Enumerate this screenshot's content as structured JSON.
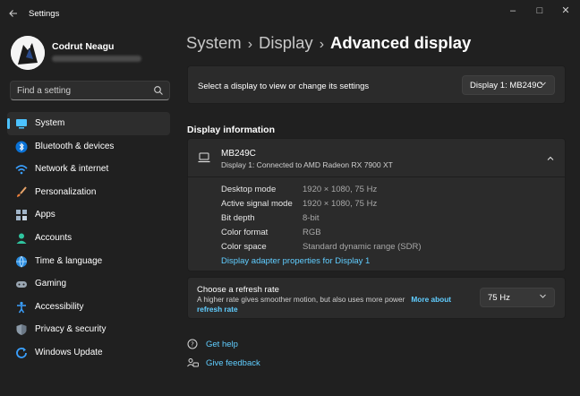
{
  "window": {
    "title": "Settings",
    "back_icon": "back-arrow-icon",
    "minimize_glyph": "–",
    "maximize_glyph": "□",
    "close_glyph": "✕"
  },
  "user": {
    "name": "Codrut Neagu",
    "email_redacted": true
  },
  "search": {
    "placeholder": "Find a setting",
    "icon": "search-icon"
  },
  "sidebar": {
    "accent_color": "#4cc2ff",
    "items": [
      {
        "label": "System",
        "icon": "system-icon",
        "active": true
      },
      {
        "label": "Bluetooth & devices",
        "icon": "bluetooth-icon",
        "active": false
      },
      {
        "label": "Network & internet",
        "icon": "wifi-icon",
        "active": false
      },
      {
        "label": "Personalization",
        "icon": "brush-icon",
        "active": false
      },
      {
        "label": "Apps",
        "icon": "apps-icon",
        "active": false
      },
      {
        "label": "Accounts",
        "icon": "accounts-icon",
        "active": false
      },
      {
        "label": "Time & language",
        "icon": "globe-clock-icon",
        "active": false
      },
      {
        "label": "Gaming",
        "icon": "gamepad-icon",
        "active": false
      },
      {
        "label": "Accessibility",
        "icon": "accessibility-icon",
        "active": false
      },
      {
        "label": "Privacy & security",
        "icon": "shield-icon",
        "active": false
      },
      {
        "label": "Windows Update",
        "icon": "windows-update-icon",
        "active": false
      }
    ]
  },
  "breadcrumb": {
    "parts": [
      "System",
      "Display"
    ],
    "separator": "›",
    "current": "Advanced display"
  },
  "display_select": {
    "label": "Select a display to view or change its settings",
    "value": "Display 1: MB249C"
  },
  "display_info": {
    "section_title": "Display information",
    "monitor_name": "MB249C",
    "monitor_subtitle": "Display 1: Connected to AMD Radeon RX 7900 XT",
    "expanded": true,
    "rows": [
      {
        "key": "Desktop mode",
        "value": "1920 × 1080, 75 Hz"
      },
      {
        "key": "Active signal mode",
        "value": "1920 × 1080, 75 Hz"
      },
      {
        "key": "Bit depth",
        "value": "8-bit"
      },
      {
        "key": "Color format",
        "value": "RGB"
      },
      {
        "key": "Color space",
        "value": "Standard dynamic range (SDR)"
      }
    ],
    "adapter_link": "Display adapter properties for Display 1"
  },
  "refresh_rate": {
    "title": "Choose a refresh rate",
    "description": "A higher rate gives smoother motion, but also uses more power",
    "more_link": "More about refresh rate",
    "value": "75 Hz"
  },
  "help": {
    "get_help": "Get help",
    "give_feedback": "Give feedback"
  },
  "colors": {
    "background": "#202020",
    "card": "#2b2b2b",
    "link": "#60cdff",
    "accent": "#4cc2ff"
  }
}
